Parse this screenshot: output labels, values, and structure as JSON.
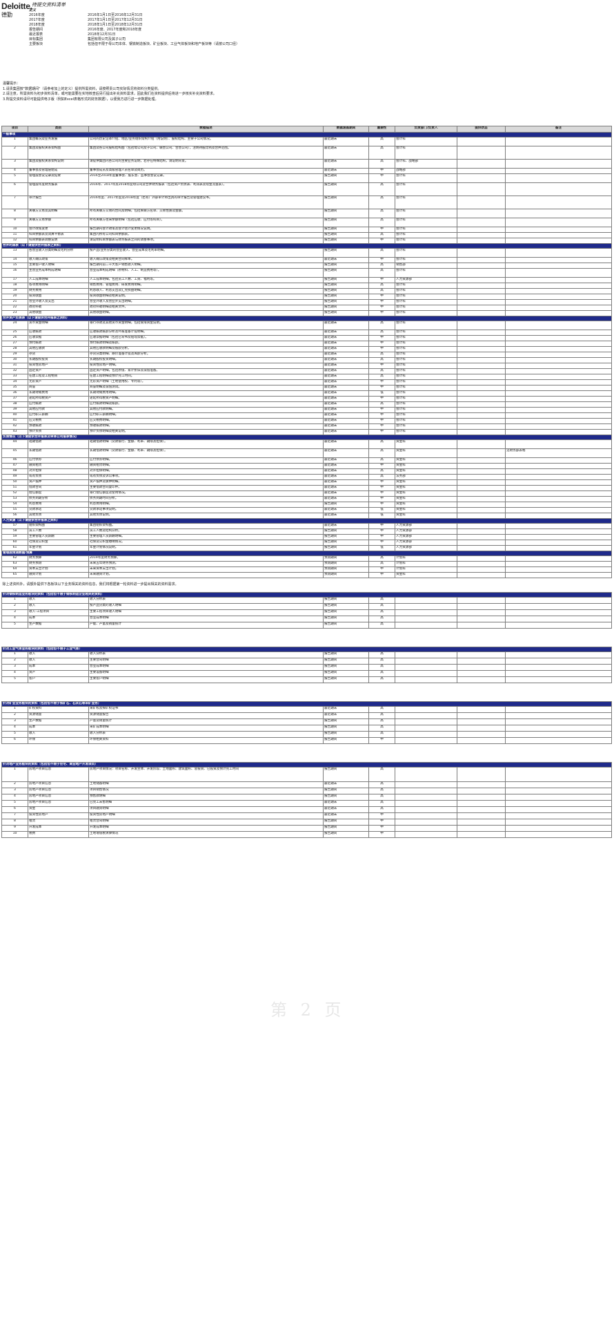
{
  "header": {
    "logo": "Deloitte.",
    "logo_cn": "德勤",
    "title": "待提交资料清单",
    "definitions_label": "定义",
    "definitions": [
      {
        "k": "2016年度",
        "v": "2016年1月1日至2016年12月31日"
      },
      {
        "k": "2017年度",
        "v": "2017年1月1日至2017年12月31日"
      },
      {
        "k": "2018年度",
        "v": "2018年1月1日至2018年12月31日"
      },
      {
        "k": "报告期间",
        "v": "2016年度、2017年度和2018年度"
      },
      {
        "k": "最近报表",
        "v": "2018年12月31日"
      },
      {
        "k": "目标集团",
        "v": "集团有限公司及其子公司"
      },
      {
        "k": "主要板块",
        "v": "包括但不限于母公司本体、钢铁制造板块、矿业板块、工业气体板块和地产板块等（请按公司口径）"
      }
    ]
  },
  "notes": {
    "title": "温馨提示：",
    "lines": [
      "1.请贵集团按\"数据期间\"（请参考加上的定义）提供所需资料，请按照贵公司实际情况将资料分类提供。",
      "2.请注意，所需资料为初步资料清单，或可能需要在实地核查后另行提出补充资料需求，因此我们在资料提供后将进一步核实补充资料要求。",
      "3.所提交资料请尽可能提供电子版（例如Excel表格形式的财务数据），以便我方进行进一步数据处理。"
    ]
  },
  "table": {
    "headers": [
      "项目",
      "类别",
      "数据描述",
      "数据涵盖期间",
      "重要性",
      "负责部门/负责人",
      "提供状态",
      "备注"
    ],
    "sections": [
      {
        "title": "一般事项",
        "rows": [
          [
            "1",
            "集团概况及业务发展",
            "公司的历史沿革介绍、地区/业务组织架构介绍（附说明）、股权结构、主要子公司情况。",
            "最近期末",
            "高",
            "会计科",
            "",
            ""
          ],
          [
            "2",
            "集团及股权关系架构图",
            "集团及各公司股权结构图（包括母公司及子公司、联营公司、合营公司），注明持股比例及合并范围。",
            "最近期末",
            "高",
            "会计科",
            "",
            ""
          ],
          [
            "3",
            "集团及股权关系架构说明",
            "请提供集团内各公司的主要业务说明，若存在特殊结构，请说明背景。",
            "最近期末",
            "高",
            "会计科、战略部",
            "",
            ""
          ],
          [
            "4",
            "董事会及管理层组成",
            "董事会成员及高级管理人员名单及简历。",
            "最近期末",
            "中",
            "战略部",
            "",
            ""
          ],
          [
            "5",
            "管理层会议记录及纪要",
            "2016至2018年度董事会、股东会、监事会会议记录。",
            "报告期间",
            "中",
            "会计科",
            "",
            ""
          ],
          [
            "6",
            "管理层年度财务报表",
            "2016年、2017年及2018年度母公司及合并财务报表（包括资产负债表、利润表及现金流量表）。",
            "报告期间",
            "高",
            "会计科",
            "",
            ""
          ],
          [
            "7",
            "审计报告",
            "2016年度、2017年度及2018年度（若有）外部审计师出具的审计报告及管理建议书。",
            "报告期间",
            "高",
            "会计科",
            "",
            ""
          ],
          [
            "8",
            "关联方交易及其明细",
            "所有关联方交易的合同及明细，包括关联方名单、交易性质及金额。",
            "报告期间",
            "高",
            "会计科",
            "",
            ""
          ],
          [
            "9",
            "关联方交易余额",
            "所有关联方往来余额明细（包括应收、应付等科目）。",
            "报告期间",
            "高",
            "会计科",
            "",
            ""
          ],
          [
            "10",
            "会计政策变更",
            "报告期内会计政策及会计估计变更情况说明。",
            "报告期间",
            "中",
            "会计科",
            "",
            ""
          ],
          [
            "11",
            "科目余额表及试算平衡表",
            "集团内所有公司科目余额表。",
            "报告期间",
            "高",
            "会计科",
            "",
            ""
          ],
          [
            "12",
            "科目余额表调整说明",
            "请说明科目余额表与财务报表之间的调整事项。",
            "报告期间",
            "中",
            "会计科",
            "",
            ""
          ]
        ]
      },
      {
        "title": "合并利润表（以下请提供合并报表之资料）",
        "rows": [
          [
            "13",
            "各营业收入分类明细及毛利分析",
            "按产品/业务分类的营业收入、营业成本及毛利率明细。",
            "报告期间",
            "高",
            "会计科",
            "",
            ""
          ],
          [
            "14",
            "收入确认政策",
            "收入确认政策及相关合同样本。",
            "最近期末",
            "中",
            "会计科",
            "",
            ""
          ],
          [
            "15",
            "主要客户收入明细",
            "报告期内前二十大客户销售收入明细。",
            "报告期间",
            "高",
            "销售部",
            "",
            ""
          ],
          [
            "16",
            "主营业务成本构成明细",
            "营业成本构成明细（原材料、人工、制造费用等）。",
            "报告期间",
            "高",
            "会计科",
            "",
            ""
          ],
          [
            "17",
            "人工成本明细",
            "人工成本明细，包括员工人数、工资、福利等。",
            "报告期间",
            "中",
            "人力资源部",
            "",
            ""
          ],
          [
            "18",
            "各项费用明细",
            "销售费用、管理费用、研发费用明细。",
            "报告期间",
            "高",
            "会计科",
            "",
            ""
          ],
          [
            "19",
            "财务费用",
            "利息收入、利息支出及汇兑损益明细。",
            "报告期间",
            "高",
            "会计科",
            "",
            ""
          ],
          [
            "20",
            "投资收益",
            "投资收益明细及相关说明。",
            "报告期间",
            "中",
            "会计科",
            "",
            ""
          ],
          [
            "21",
            "营业外收入及支出",
            "营业外收入及营业外支出明细。",
            "报告期间",
            "中",
            "会计科",
            "",
            ""
          ],
          [
            "22",
            "政府补助",
            "政府补助明细及相关文件。",
            "报告期间",
            "中",
            "会计科",
            "",
            ""
          ],
          [
            "23",
            "其他收益",
            "其他收益明细。",
            "报告期间",
            "中",
            "会计科",
            "",
            ""
          ]
        ]
      },
      {
        "title": "合并资产负债表（以下请提供合并报表之资料）",
        "rows": [
          [
            "24",
            "货币资金明细",
            "银行存款及其他货币资金明细，包括受限资金说明。",
            "最近期末",
            "高",
            "会计科",
            "",
            ""
          ],
          [
            "25",
            "应收账款",
            "应收账款账龄分析及坏账准备计提明细。",
            "最近期末",
            "高",
            "会计科",
            "",
            ""
          ],
          [
            "26",
            "应收票据",
            "应收票据明细（包括已背书及贴现票据）。",
            "最近期末",
            "中",
            "会计科",
            "",
            ""
          ],
          [
            "27",
            "预付账款",
            "预付账款明细及账龄。",
            "最近期末",
            "中",
            "会计科",
            "",
            ""
          ],
          [
            "28",
            "其他应收款",
            "其他应收款明细及账龄分析。",
            "最近期末",
            "中",
            "会计科",
            "",
            ""
          ],
          [
            "29",
            "存货",
            "存货分类明细、跌价准备计提及库龄分析。",
            "最近期末",
            "高",
            "会计科",
            "",
            ""
          ],
          [
            "30",
            "长期股权投资",
            "长期股权投资明细。",
            "最近期末",
            "高",
            "会计科",
            "",
            ""
          ],
          [
            "31",
            "投资性房地产",
            "投资性房地产明细。",
            "最近期末",
            "中",
            "会计科",
            "",
            ""
          ],
          [
            "32",
            "固定资产",
            "固定资产明细，包括原值、累计折旧及减值准备。",
            "最近期末",
            "高",
            "会计科",
            "",
            ""
          ],
          [
            "33",
            "在建工程及工程物资",
            "在建工程明细及预计完工时间。",
            "最近期末",
            "高",
            "会计科",
            "",
            ""
          ],
          [
            "34",
            "无形资产",
            "无形资产明细（土地使用权、专利等）。",
            "最近期末",
            "中",
            "会计科",
            "",
            ""
          ],
          [
            "35",
            "商誉",
            "商誉明细及减值测试。",
            "最近期末",
            "中",
            "会计科",
            "",
            ""
          ],
          [
            "36",
            "长期待摊费用",
            "长期待摊费用明细。",
            "最近期末",
            "低",
            "会计科",
            "",
            ""
          ],
          [
            "37",
            "递延所得税资产",
            "递延所得税资产明细。",
            "最近期末",
            "中",
            "会计科",
            "",
            ""
          ],
          [
            "38",
            "应付账款",
            "应付账款明细及账龄。",
            "最近期末",
            "高",
            "会计科",
            "",
            ""
          ],
          [
            "39",
            "其他应付款",
            "其他应付款明细。",
            "最近期末",
            "中",
            "会计科",
            "",
            ""
          ],
          [
            "40",
            "应付职工薪酬",
            "应付职工薪酬明细。",
            "最近期末",
            "中",
            "会计科",
            "",
            ""
          ],
          [
            "41",
            "应交税费",
            "应交税费明细。",
            "最近期末",
            "中",
            "会计科",
            "",
            ""
          ],
          [
            "42",
            "预收账款",
            "预收账款明细。",
            "最近期末",
            "中",
            "会计科",
            "",
            ""
          ],
          [
            "43",
            "预计负债",
            "预计负债明细及相关说明。",
            "最近期末",
            "中",
            "会计科",
            "",
            ""
          ]
        ]
      },
      {
        "title": "负债情况（以下请提供合并报表及单体公司报表情况）",
        "rows": [
          [
            "44",
            "短期借款",
            "短期借款明细（贷款银行、金额、利率、期限及担保）。",
            "最近期末",
            "高",
            "资金科",
            "",
            ""
          ],
          [
            "45",
            "长期借款",
            "长期借款明细（贷款银行、金额、利率、期限及担保）。",
            "最近期末",
            "高",
            "资金科",
            "",
            "见财务部表格"
          ],
          [
            "46",
            "应付债券",
            "应付债券明细。",
            "最近期末",
            "高",
            "资金科",
            "",
            ""
          ],
          [
            "47",
            "融资租赁",
            "融资租赁明细。",
            "最近期末",
            "中",
            "资金科",
            "",
            ""
          ],
          [
            "48",
            "对外担保",
            "对外担保明细。",
            "最近期末",
            "高",
            "资金科",
            "",
            ""
          ],
          [
            "49",
            "或有负债",
            "或有负债及诉讼事项。",
            "最近期末",
            "高",
            "法务部",
            "",
            ""
          ],
          [
            "50",
            "资产抵押",
            "资产抵押及质押明细。",
            "最近期末",
            "中",
            "资金科",
            "",
            ""
          ],
          [
            "51",
            "借款合同",
            "主要借款合同复印件。",
            "最近期末",
            "中",
            "资金科",
            "",
            ""
          ],
          [
            "52",
            "授信额度",
            "银行授信额度及使用情况。",
            "最近期末",
            "中",
            "资金科",
            "",
            ""
          ],
          [
            "53",
            "债务到期分析",
            "债务到期时间分析。",
            "最近期末",
            "中",
            "资金科",
            "",
            ""
          ],
          [
            "54",
            "利息费用",
            "利息费用明细。",
            "报告期间",
            "中",
            "资金科",
            "",
            ""
          ],
          [
            "55",
            "贷款承诺",
            "贷款承诺事项说明。",
            "最近期末",
            "低",
            "资金科",
            "",
            ""
          ],
          [
            "56",
            "其他负债",
            "其他负债说明。",
            "最近期末",
            "低",
            "资金科",
            "",
            ""
          ]
        ]
      },
      {
        "title": "人力资源（以下请提供合并报表之资料）",
        "rows": [
          [
            "57",
            "组织架构图",
            "集团组织架构图。",
            "最近期末",
            "中",
            "人力资源部",
            "",
            ""
          ],
          [
            "58",
            "员工人数",
            "员工人数及结构分析。",
            "报告期间",
            "中",
            "人力资源部",
            "",
            ""
          ],
          [
            "59",
            "主要管理人员薪酬",
            "主要管理人员薪酬明细。",
            "报告期间",
            "中",
            "人力资源部",
            "",
            ""
          ],
          [
            "60",
            "社保及公积金",
            "社保及公积金缴纳情况。",
            "报告期间",
            "中",
            "人力资源部",
            "",
            ""
          ],
          [
            "61",
            "年金计划",
            "年金计划情况说明。",
            "报告期间",
            "低",
            "人力资源部",
            "",
            ""
          ]
        ]
      },
      {
        "title": "管理层预测数据/预算",
        "rows": [
          [
            "62",
            "财务预算",
            "2019年度财务预算。",
            "预测期间",
            "高",
            "计划科",
            "",
            ""
          ],
          [
            "63",
            "财务预测",
            "未来五年财务预测。",
            "预测期间",
            "高",
            "计划科",
            "",
            ""
          ],
          [
            "64",
            "资本支出计划",
            "未来资本支出计划。",
            "预测期间",
            "中",
            "计划科",
            "",
            ""
          ],
          [
            "65",
            "融资计划",
            "未来融资计划。",
            "预测期间",
            "中",
            "资金科",
            "",
            ""
          ]
        ]
      }
    ]
  },
  "mid_note": "除上述资料外，请额外提供下各板块以下业务相关的资料信息，我们将根据第一轮资料进一步提出相关的资料需求。",
  "plates": [
    {
      "title": "针对钢铁制造业务板块的资料（包括但不限于钢铁制造企业相关的资料）",
      "rows": [
        [
          "1",
          "收入",
          "收入分析表",
          "报告期间",
          "高",
          "",
          "",
          ""
        ],
        [
          "2",
          "收入",
          "按产品分类的收入明细",
          "报告期间",
          "高",
          "",
          "",
          ""
        ],
        [
          "3",
          "收入-工程项目",
          "主要工程项目收入明细",
          "报告期间",
          "高",
          "",
          "",
          ""
        ],
        [
          "4",
          "成本",
          "营业成本明细",
          "报告期间",
          "高",
          "",
          "",
          ""
        ],
        [
          "5",
          "生产数据",
          "产能、产量及销量统计",
          "报告期间",
          "高",
          "",
          "",
          ""
        ]
      ]
    },
    {
      "title": "针对工业气体业务板块的资料（包括但不限于工业气体）",
      "rows": [
        [
          "1",
          "收入",
          "收入分析表",
          "报告期间",
          "高",
          "",
          "",
          ""
        ],
        [
          "2",
          "收入",
          "主要合同明细",
          "报告期间",
          "高",
          "",
          "",
          ""
        ],
        [
          "3",
          "成本",
          "营业成本明细",
          "报告期间",
          "高",
          "",
          "",
          ""
        ],
        [
          "4",
          "资产",
          "主要设备明细",
          "报告期间",
          "高",
          "",
          "",
          ""
        ],
        [
          "5",
          "客户",
          "主要客户明细",
          "报告期间",
          "高",
          "",
          "",
          ""
        ]
      ]
    },
    {
      "title": "针对矿业业务板块的资料（包括但不限于铁矿石、石灰石等采矿业务）",
      "rows": [
        [
          "1",
          "矿权资料",
          "采矿权及探矿权证书",
          "最近期末",
          "高",
          "",
          "",
          ""
        ],
        [
          "2",
          "资源储量",
          "资源储量报告",
          "最近期末",
          "高",
          "",
          "",
          ""
        ],
        [
          "3",
          "生产数据",
          "产量及销量统计",
          "报告期间",
          "高",
          "",
          "",
          ""
        ],
        [
          "4",
          "成本",
          "采矿成本明细",
          "报告期间",
          "高",
          "",
          "",
          ""
        ],
        [
          "5",
          "收入",
          "收入分析表",
          "报告期间",
          "高",
          "",
          "",
          ""
        ],
        [
          "6",
          "环保",
          "环保相关资料",
          "报告期间",
          "中",
          "",
          "",
          ""
        ]
      ]
    },
    {
      "title": "针对地产业务板块的资料（包括但不限于住宅、商业地产开发项目）",
      "rows": [
        [
          "1",
          "房地产项目信息",
          "房地产项目情况：项目名称、开发主体、开发阶段、土地面积、建筑面积、总投资、已投资及预计完工时间",
          "报告期间",
          "高",
          "",
          "",
          ""
        ],
        [
          "2",
          "房地产项目信息",
          "土地储备明细",
          "最近期末",
          "高",
          "",
          "",
          ""
        ],
        [
          "3",
          "房地产项目信息",
          "项目销售情况",
          "报告期间",
          "高",
          "",
          "",
          ""
        ],
        [
          "4",
          "房地产项目信息",
          "预售款明细",
          "报告期间",
          "高",
          "",
          "",
          ""
        ],
        [
          "5",
          "房地产项目信息",
          "已完工未售明细",
          "最近期末",
          "高",
          "",
          "",
          ""
        ],
        [
          "6",
          "资金",
          "项目融资明细",
          "最近期末",
          "高",
          "",
          "",
          ""
        ],
        [
          "7",
          "投资性房地产",
          "投资性房地产明细",
          "最近期末",
          "中",
          "",
          "",
          ""
        ],
        [
          "8",
          "租赁",
          "租赁合同明细",
          "报告期间",
          "中",
          "",
          "",
          ""
        ],
        [
          "9",
          "开发成本",
          "开发成本明细",
          "报告期间",
          "中",
          "",
          "",
          ""
        ],
        [
          "10",
          "税费",
          "土地增值税清算情况",
          "报告期间",
          "中",
          "",
          "",
          ""
        ]
      ]
    }
  ],
  "watermark": "第 2 页"
}
